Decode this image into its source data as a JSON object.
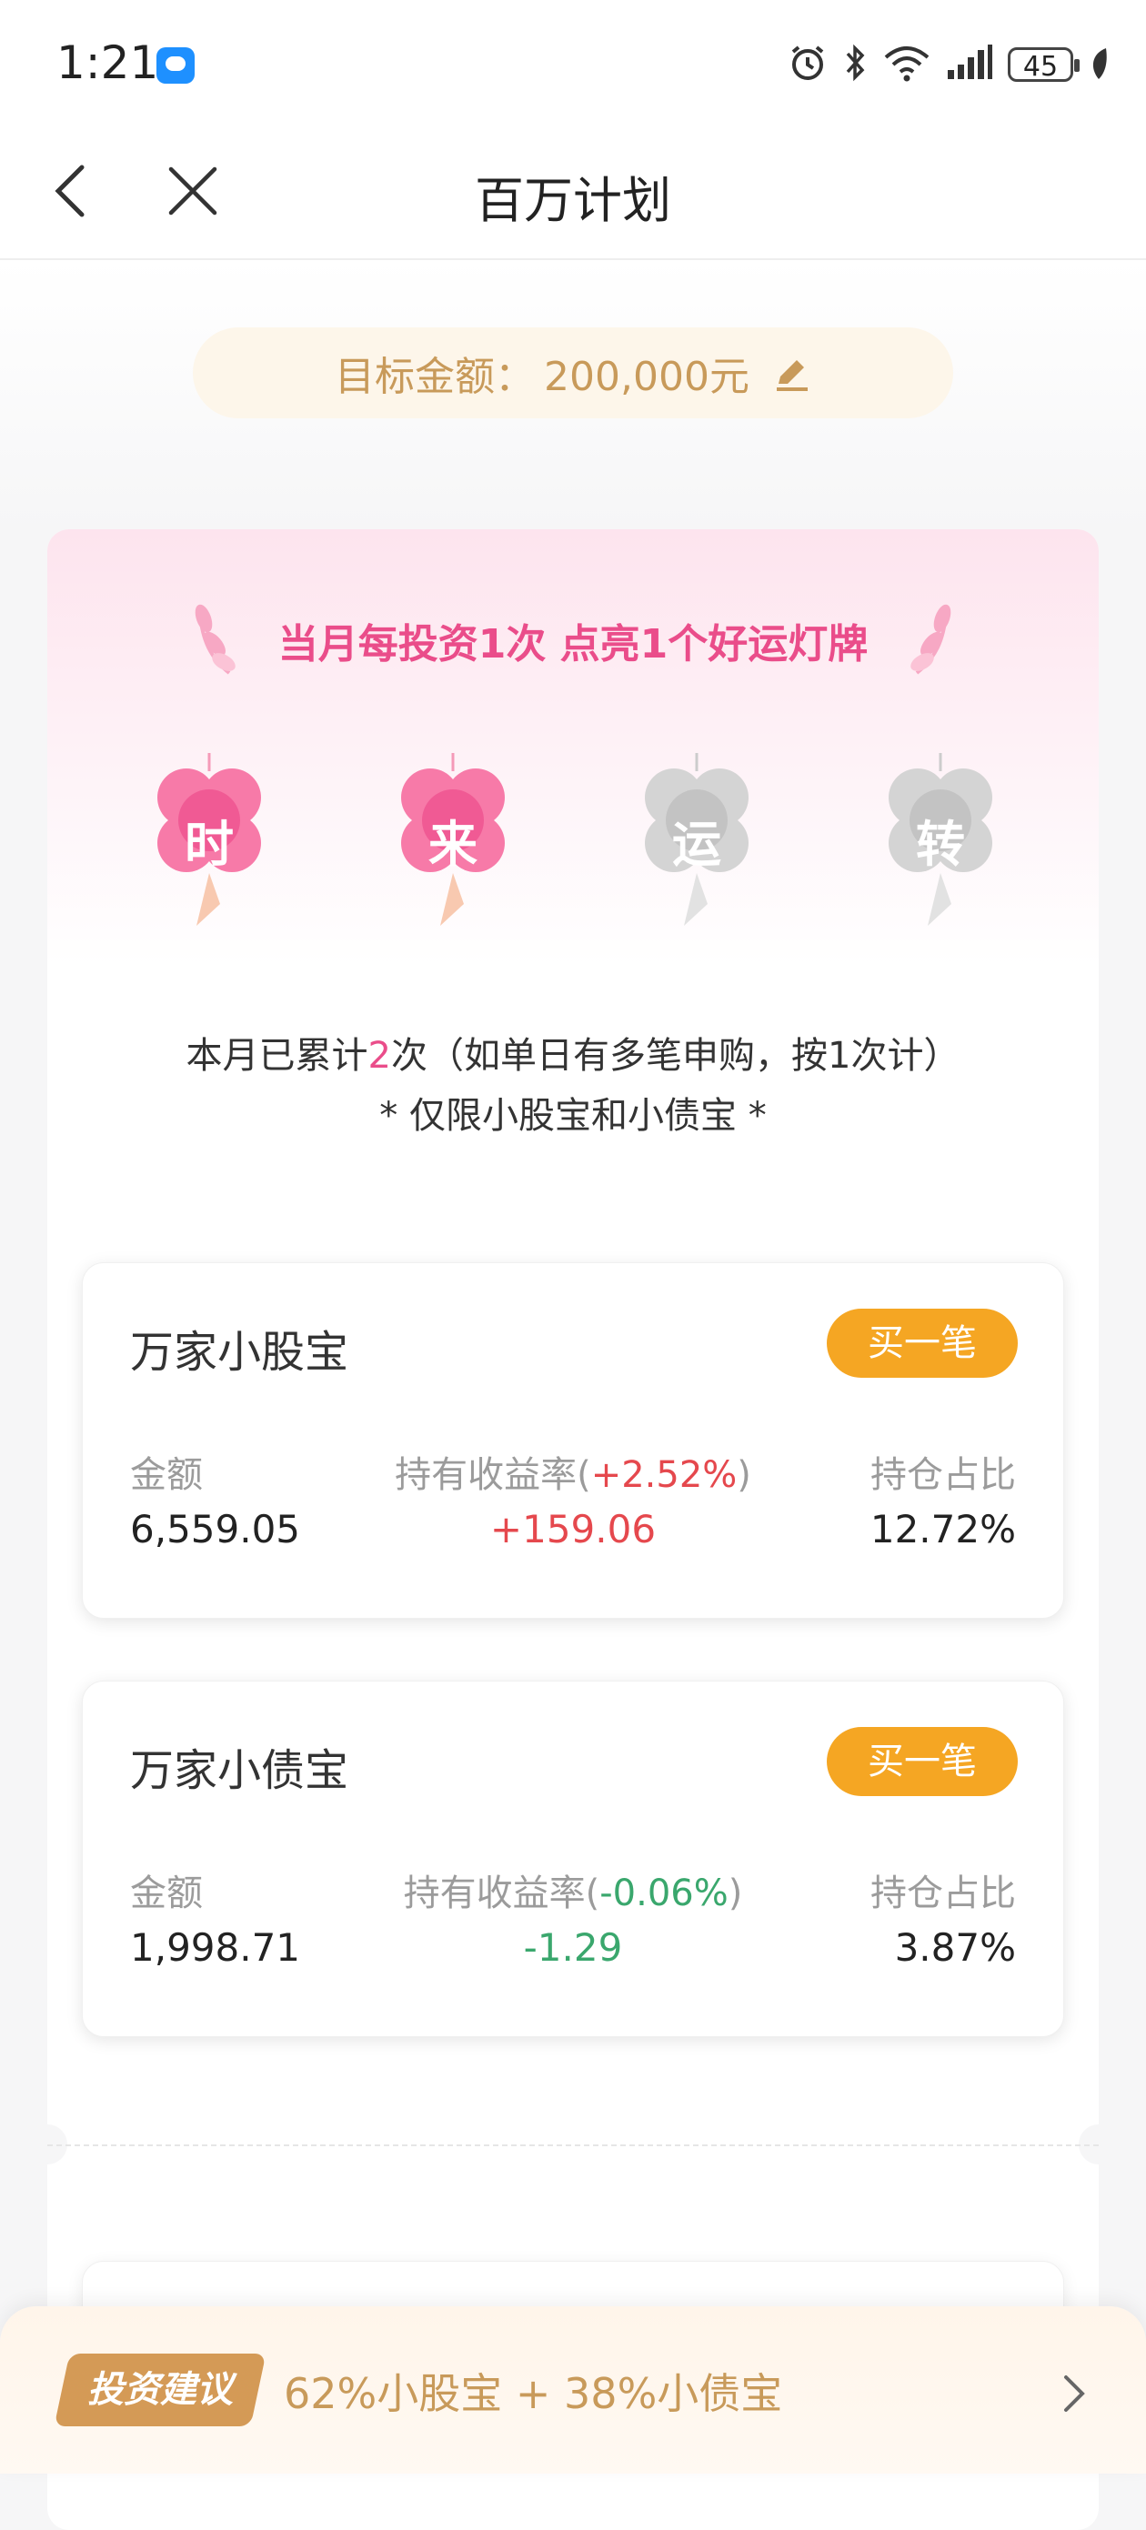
{
  "status_bar": {
    "time": "1:21",
    "battery": "45"
  },
  "nav": {
    "title": "百万计划"
  },
  "target": {
    "label": "目标金额：",
    "amount": "200,000元"
  },
  "banner": {
    "text": "当月每投资1次 点亮1个好运灯牌"
  },
  "lanterns": [
    {
      "char": "时",
      "lit": true
    },
    {
      "char": "来",
      "lit": true
    },
    {
      "char": "运",
      "lit": false
    },
    {
      "char": "转",
      "lit": false
    }
  ],
  "count": {
    "prefix": "本月已累计",
    "number": "2",
    "suffix": "次（如单日有多笔申购，按1次计）"
  },
  "limit_note": "* 仅限小股宝和小债宝 *",
  "funds": [
    {
      "name": "万家小股宝",
      "buy_label": "买一笔",
      "amount_label": "金额",
      "amount": "6,559.05",
      "yield_label": "持有收益率(",
      "yield_rate": "+2.52%",
      "yield_close": ")",
      "profit": "+159.06",
      "share_label": "持仓占比",
      "share": "12.72%"
    },
    {
      "name": "万家小债宝",
      "buy_label": "买一笔",
      "amount_label": "金额",
      "amount": "1,998.71",
      "yield_label": "持有收益率(",
      "yield_rate": "-0.06%",
      "yield_close": ")",
      "profit": "-1.29",
      "share_label": "持仓占比",
      "share": "3.87%"
    }
  ],
  "advice": {
    "tag": "投资建议",
    "text": "62%小股宝 + 38%小债宝"
  },
  "colors": {
    "pink": "#ea4d8a",
    "gold": "#c89a5a",
    "orange": "#f5a623",
    "red": "#e5484d",
    "green": "#3aa76d"
  }
}
